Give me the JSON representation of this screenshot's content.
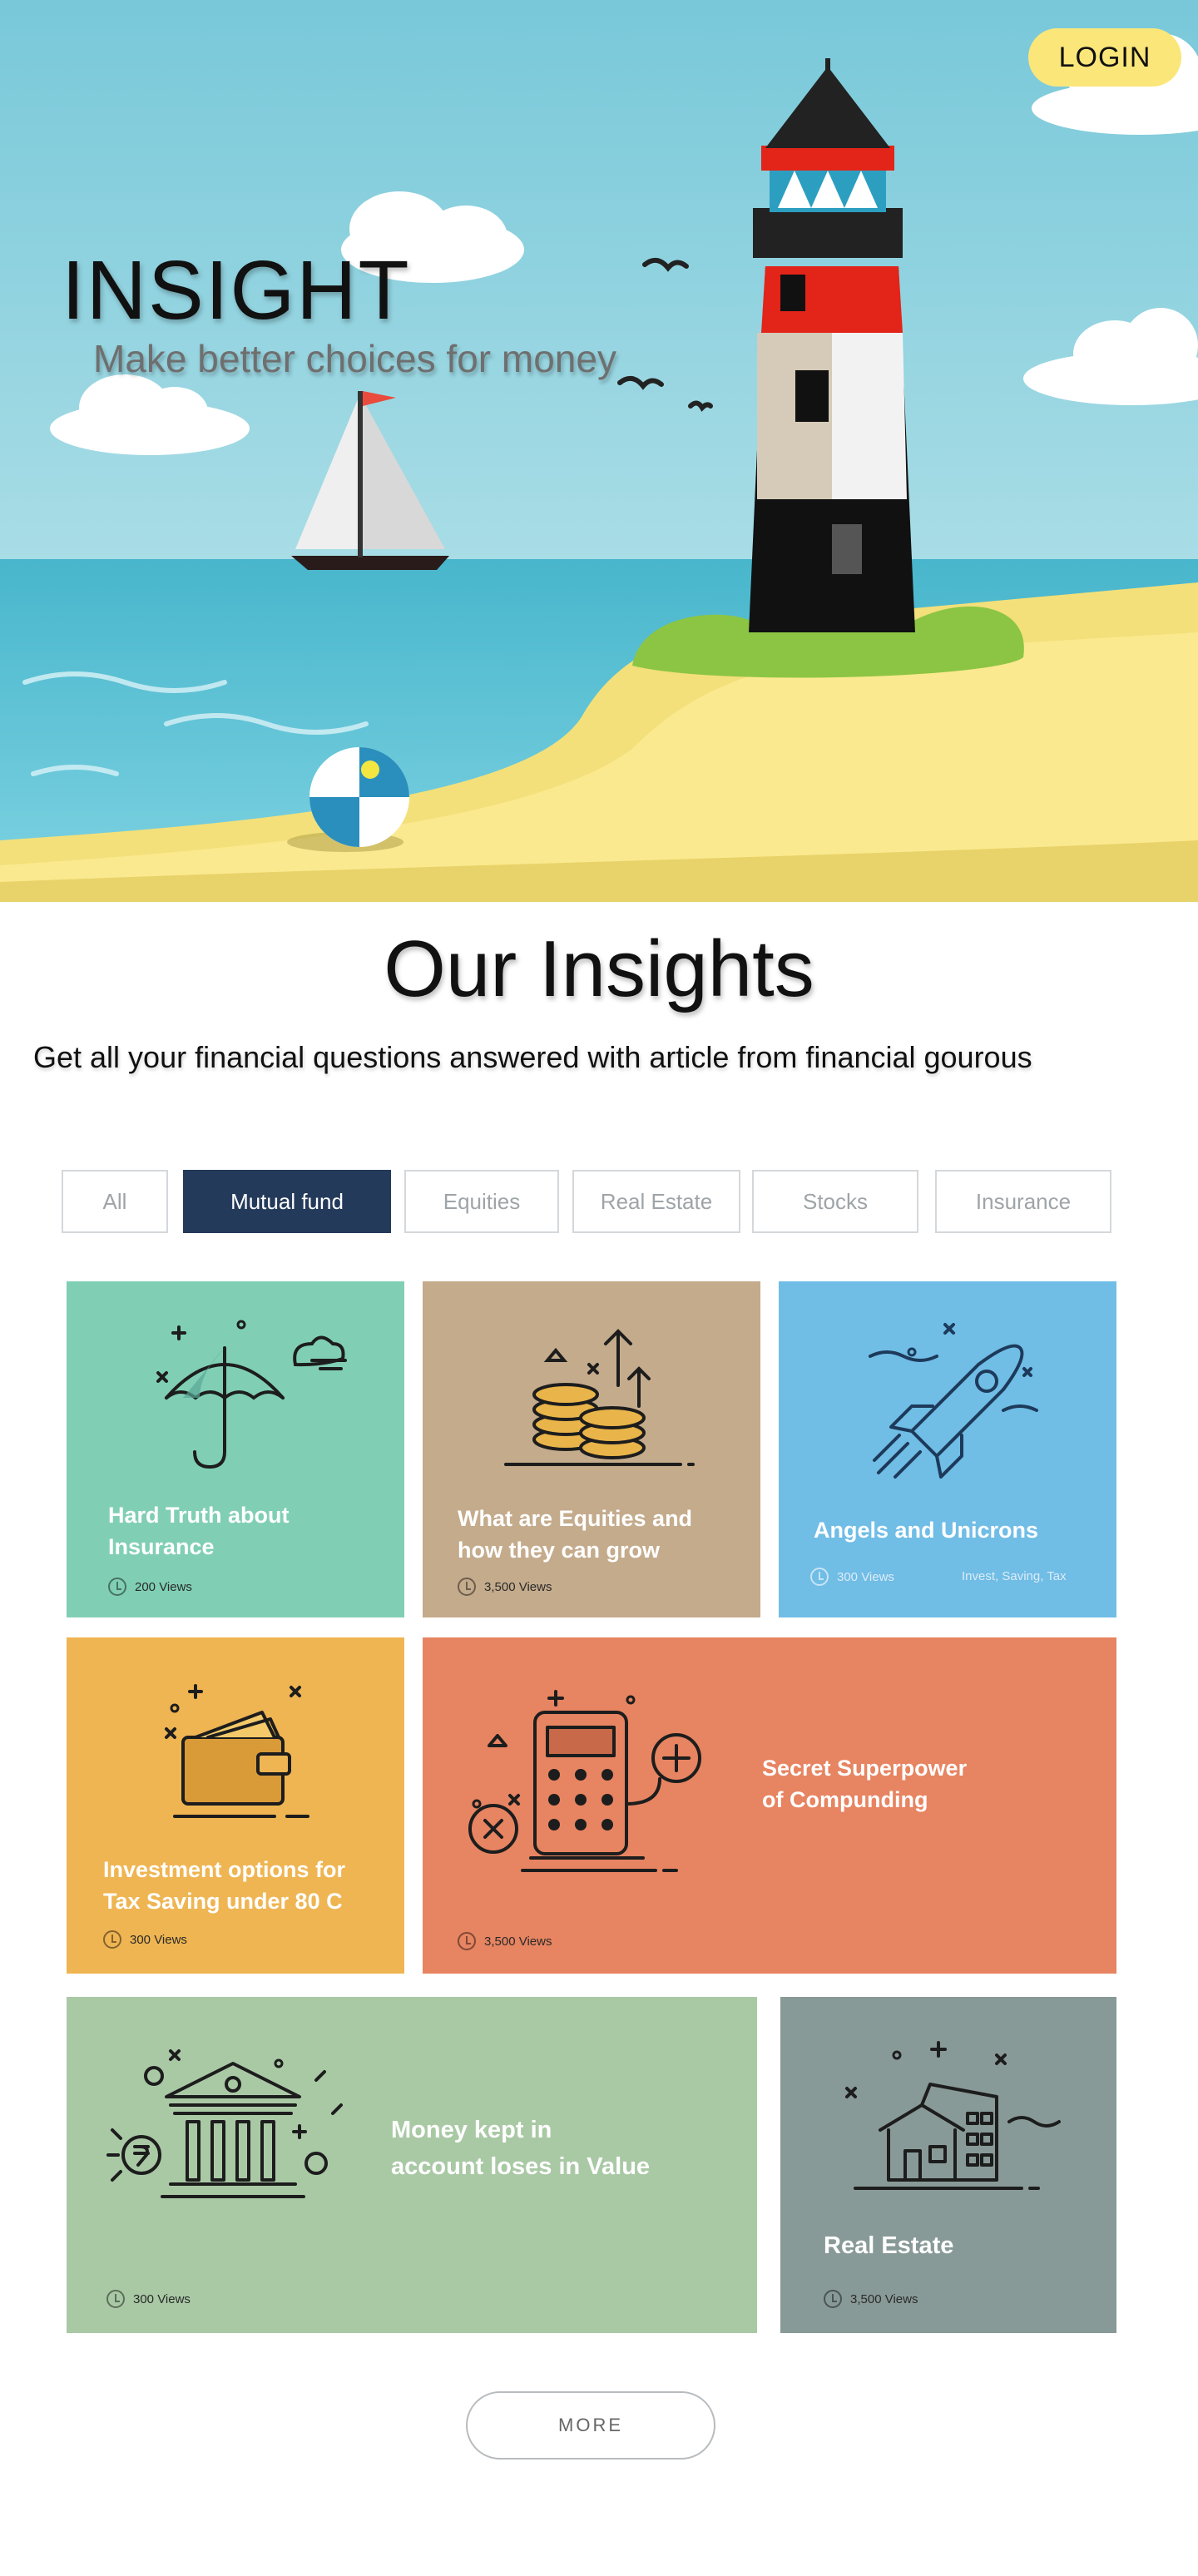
{
  "header": {
    "brand": "INSIGHT",
    "tagline": "Make better choices for money",
    "login_label": "LOGIN"
  },
  "section": {
    "title": "Our Insights",
    "subtitle": "Get all your  financial questions answered with article from financial gourous"
  },
  "filters": [
    {
      "label": "All",
      "active": false
    },
    {
      "label": "Mutual fund",
      "active": true
    },
    {
      "label": "Equities",
      "active": false
    },
    {
      "label": "Real Estate",
      "active": false
    },
    {
      "label": "Stocks",
      "active": false
    },
    {
      "label": "Insurance",
      "active": false
    }
  ],
  "cards": [
    {
      "title_line1": "Hard Truth about",
      "title_line2": "Insurance",
      "views": "200 Views",
      "icon": "umbrella-icon",
      "color": "#80cfb5"
    },
    {
      "title_line1": "What are Equities and",
      "title_line2": "how they can grow",
      "views": "3,500 Views",
      "icon": "coins-growth-icon",
      "color": "#c4ab8c"
    },
    {
      "title_line1": "Angels and Unicrons",
      "title_line2": "",
      "views": "300 Views",
      "tags": "Invest,  Saving,  Tax",
      "icon": "rocket-icon",
      "color": "#70bde6"
    },
    {
      "title_line1": "Investment options for",
      "title_line2": "Tax Saving under 80 C",
      "views": "300 Views",
      "icon": "wallet-icon",
      "color": "#efb552"
    },
    {
      "title_line1": "Secret Superpower",
      "title_line2": "of Compunding",
      "views": "3,500 Views",
      "icon": "calculator-icon",
      "color": "#e78461"
    },
    {
      "title_line1": "Money kept in",
      "title_line2": "account loses in Value",
      "views": "300 Views",
      "icon": "bank-icon",
      "color": "#a9c9a5"
    },
    {
      "title_line1": "Real Estate",
      "title_line2": "",
      "views": "3,500 Views",
      "icon": "house-icon",
      "color": "#889a97"
    }
  ],
  "more_label": "MORE"
}
